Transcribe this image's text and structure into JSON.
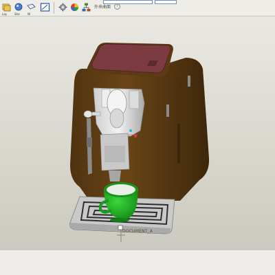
{
  "toolbar": {
    "buttons": [
      {
        "icon": "layer-icon",
        "label": "Lay"
      },
      {
        "icon": "shade-icon",
        "label": "Sha"
      },
      {
        "icon": "wire-icon",
        "label": "W"
      },
      {
        "icon": "view-icon",
        "label": ""
      },
      {
        "icon": "settings-icon",
        "label": ""
      },
      {
        "icon": "palette-icon",
        "label": ""
      },
      {
        "icon": "tree-icon",
        "label": ""
      }
    ],
    "appearance_label": "外来曲面",
    "help_symbol": "?"
  },
  "model": {
    "csys_label": "DOCUMENT_A"
  },
  "colors": {
    "body_brown": "#5e3c14",
    "lid_maroon": "#7c3b40",
    "cup_green": "#1a9a1f",
    "tray_grey": "#c8c8c8"
  }
}
